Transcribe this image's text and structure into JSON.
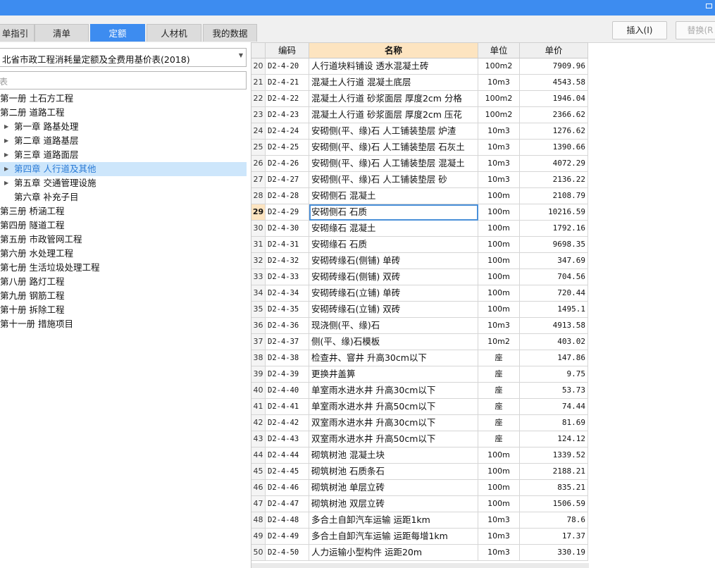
{
  "tabs": [
    "单指引",
    "清单",
    "定额",
    "人材机",
    "我的数据"
  ],
  "active_tab": 2,
  "buttons": {
    "insert": "插入(I)",
    "replace": "替换(R"
  },
  "left": {
    "library": "北省市政工程消耗量定额及全费用基价表(2018)",
    "search_placeholder": "表",
    "tree": [
      {
        "label": "第一册 土石方工程",
        "level": 0
      },
      {
        "label": "第二册 道路工程",
        "level": 0
      },
      {
        "label": "第一章 路基处理",
        "level": 1,
        "arrow": true
      },
      {
        "label": "第二章 道路基层",
        "level": 1,
        "arrow": true
      },
      {
        "label": "第三章 道路面层",
        "level": 1,
        "arrow": true
      },
      {
        "label": "第四章 人行道及其他",
        "level": 1,
        "arrow": true,
        "selected": true
      },
      {
        "label": "第五章 交通管理设施",
        "level": 1,
        "arrow": true
      },
      {
        "label": "第六章 补充子目",
        "level": 1
      },
      {
        "label": "第三册 桥涵工程",
        "level": 0
      },
      {
        "label": "第四册 隧道工程",
        "level": 0
      },
      {
        "label": "第五册 市政管网工程",
        "level": 0
      },
      {
        "label": "第六册 水处理工程",
        "level": 0
      },
      {
        "label": "第七册 生活垃圾处理工程",
        "level": 0
      },
      {
        "label": "第八册 路灯工程",
        "level": 0
      },
      {
        "label": "第九册 钢筋工程",
        "level": 0
      },
      {
        "label": "第十册 拆除工程",
        "level": 0
      },
      {
        "label": "第十一册 措施项目",
        "level": 0
      }
    ]
  },
  "grid": {
    "headers": [
      "",
      "编码",
      "名称",
      "单位",
      "单价"
    ],
    "current_row": 29,
    "rows": [
      {
        "n": "20",
        "code": "D2-4-20",
        "name": "人行道块料铺设 透水混凝土砖",
        "unit": "100m2",
        "price": "7909.96"
      },
      {
        "n": "21",
        "code": "D2-4-21",
        "name": "混凝土人行道 混凝土底层",
        "unit": "10m3",
        "price": "4543.58"
      },
      {
        "n": "22",
        "code": "D2-4-22",
        "name": "混凝土人行道 砂浆面层 厚度2cm 分格",
        "unit": "100m2",
        "price": "1946.04"
      },
      {
        "n": "23",
        "code": "D2-4-23",
        "name": "混凝土人行道 砂浆面层 厚度2cm 压花",
        "unit": "100m2",
        "price": "2366.62"
      },
      {
        "n": "24",
        "code": "D2-4-24",
        "name": "安砌侧(平、缘)石 人工铺装垫层 炉渣",
        "unit": "10m3",
        "price": "1276.62"
      },
      {
        "n": "25",
        "code": "D2-4-25",
        "name": "安砌侧(平、缘)石 人工铺装垫层 石灰土",
        "unit": "10m3",
        "price": "1390.66"
      },
      {
        "n": "26",
        "code": "D2-4-26",
        "name": "安砌侧(平、缘)石 人工铺装垫层 混凝土",
        "unit": "10m3",
        "price": "4072.29"
      },
      {
        "n": "27",
        "code": "D2-4-27",
        "name": "安砌侧(平、缘)石 人工铺装垫层 砂",
        "unit": "10m3",
        "price": "2136.22"
      },
      {
        "n": "28",
        "code": "D2-4-28",
        "name": "安砌侧石 混凝土",
        "unit": "100m",
        "price": "2108.79"
      },
      {
        "n": "29",
        "code": "D2-4-29",
        "name": "安砌侧石 石质",
        "unit": "100m",
        "price": "10216.59"
      },
      {
        "n": "30",
        "code": "D2-4-30",
        "name": "安砌缘石 混凝土",
        "unit": "100m",
        "price": "1792.16"
      },
      {
        "n": "31",
        "code": "D2-4-31",
        "name": "安砌缘石 石质",
        "unit": "100m",
        "price": "9698.35"
      },
      {
        "n": "32",
        "code": "D2-4-32",
        "name": "安砌砖缘石(侧铺) 单砖",
        "unit": "100m",
        "price": "347.69"
      },
      {
        "n": "33",
        "code": "D2-4-33",
        "name": "安砌砖缘石(侧铺) 双砖",
        "unit": "100m",
        "price": "704.56"
      },
      {
        "n": "34",
        "code": "D2-4-34",
        "name": "安砌砖缘石(立铺) 单砖",
        "unit": "100m",
        "price": "720.44"
      },
      {
        "n": "35",
        "code": "D2-4-35",
        "name": "安砌砖缘石(立铺) 双砖",
        "unit": "100m",
        "price": "1495.1"
      },
      {
        "n": "36",
        "code": "D2-4-36",
        "name": "现浇侧(平、缘)石",
        "unit": "10m3",
        "price": "4913.58"
      },
      {
        "n": "37",
        "code": "D2-4-37",
        "name": "侧(平、缘)石模板",
        "unit": "10m2",
        "price": "403.02"
      },
      {
        "n": "38",
        "code": "D2-4-38",
        "name": "检查井、窨井 升高30cm以下",
        "unit": "座",
        "price": "147.86"
      },
      {
        "n": "39",
        "code": "D2-4-39",
        "name": "更换井盖箅",
        "unit": "座",
        "price": "9.75"
      },
      {
        "n": "40",
        "code": "D2-4-40",
        "name": "单室雨水进水井 升高30cm以下",
        "unit": "座",
        "price": "53.73"
      },
      {
        "n": "41",
        "code": "D2-4-41",
        "name": "单室雨水进水井 升高50cm以下",
        "unit": "座",
        "price": "74.44"
      },
      {
        "n": "42",
        "code": "D2-4-42",
        "name": "双室雨水进水井 升高30cm以下",
        "unit": "座",
        "price": "81.69"
      },
      {
        "n": "43",
        "code": "D2-4-43",
        "name": "双室雨水进水井 升高50cm以下",
        "unit": "座",
        "price": "124.12"
      },
      {
        "n": "44",
        "code": "D2-4-44",
        "name": "砌筑树池 混凝土块",
        "unit": "100m",
        "price": "1339.52"
      },
      {
        "n": "45",
        "code": "D2-4-45",
        "name": "砌筑树池 石质条石",
        "unit": "100m",
        "price": "2188.21"
      },
      {
        "n": "46",
        "code": "D2-4-46",
        "name": "砌筑树池 单层立砖",
        "unit": "100m",
        "price": "835.21"
      },
      {
        "n": "47",
        "code": "D2-4-47",
        "name": "砌筑树池 双层立砖",
        "unit": "100m",
        "price": "1506.59"
      },
      {
        "n": "48",
        "code": "D2-4-48",
        "name": "多合土自卸汽车运输 运距1km",
        "unit": "10m3",
        "price": "78.6"
      },
      {
        "n": "49",
        "code": "D2-4-49",
        "name": "多合土自卸汽车运输 运距每增1km",
        "unit": "10m3",
        "price": "17.37"
      },
      {
        "n": "50",
        "code": "D2-4-50",
        "name": "人力运输小型构件 运距20m",
        "unit": "10m3",
        "price": "330.19"
      }
    ]
  },
  "colors": {
    "accent": "#3d8cf0",
    "header_highlight": "#fde4c0",
    "tree_selected": "#cde6fb"
  }
}
